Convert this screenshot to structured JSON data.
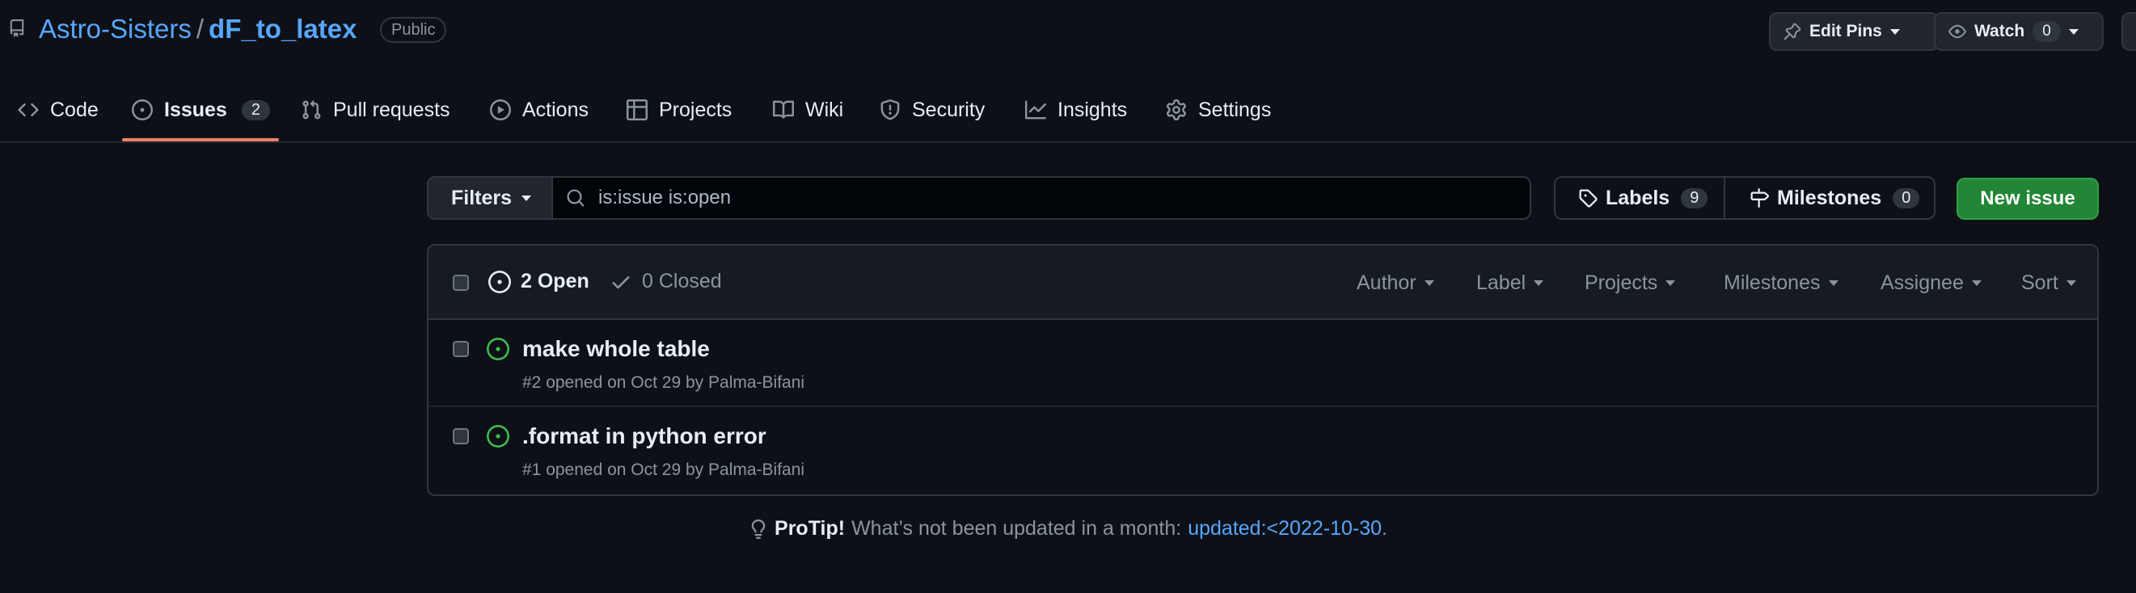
{
  "repo": {
    "owner": "Astro-Sisters",
    "separator": "/",
    "name": "dF_to_latex",
    "visibility": "Public",
    "icon": "repo-icon"
  },
  "header_actions": {
    "edit_pins_label": "Edit Pins",
    "watch_label": "Watch",
    "watch_count": "0"
  },
  "nav": {
    "tabs": [
      {
        "label": "Code",
        "icon": "code-icon"
      },
      {
        "label": "Issues",
        "icon": "issue-opened-icon",
        "count": "2",
        "active": true
      },
      {
        "label": "Pull requests",
        "icon": "git-pull-request-icon"
      },
      {
        "label": "Actions",
        "icon": "play-icon"
      },
      {
        "label": "Projects",
        "icon": "table-icon"
      },
      {
        "label": "Wiki",
        "icon": "book-icon"
      },
      {
        "label": "Security",
        "icon": "shield-icon"
      },
      {
        "label": "Insights",
        "icon": "graph-icon"
      },
      {
        "label": "Settings",
        "icon": "gear-icon"
      }
    ]
  },
  "filter_bar": {
    "filters_label": "Filters",
    "search_value": "is:issue is:open",
    "labels_label": "Labels",
    "labels_count": "9",
    "milestones_label": "Milestones",
    "milestones_count": "0",
    "new_issue_label": "New issue"
  },
  "issues_header": {
    "open_label": "2 Open",
    "closed_label": "0 Closed",
    "filters": [
      "Author",
      "Label",
      "Projects",
      "Milestones",
      "Assignee",
      "Sort"
    ]
  },
  "issues": [
    {
      "title": "make whole table",
      "meta": "#2 opened on Oct 29 by Palma-Bifani"
    },
    {
      "title": ".format in python error",
      "meta": "#1 opened on Oct 29 by Palma-Bifani"
    }
  ],
  "protip": {
    "strong": "ProTip!",
    "text": "What’s not been updated in a month:",
    "link": "updated:<2022-10-30",
    "end": "."
  },
  "colors": {
    "background": "#0d1117",
    "link": "#58a6ff",
    "open_green": "#3fb950",
    "primary_button": "#238636",
    "active_tab_underline": "#f78166"
  }
}
